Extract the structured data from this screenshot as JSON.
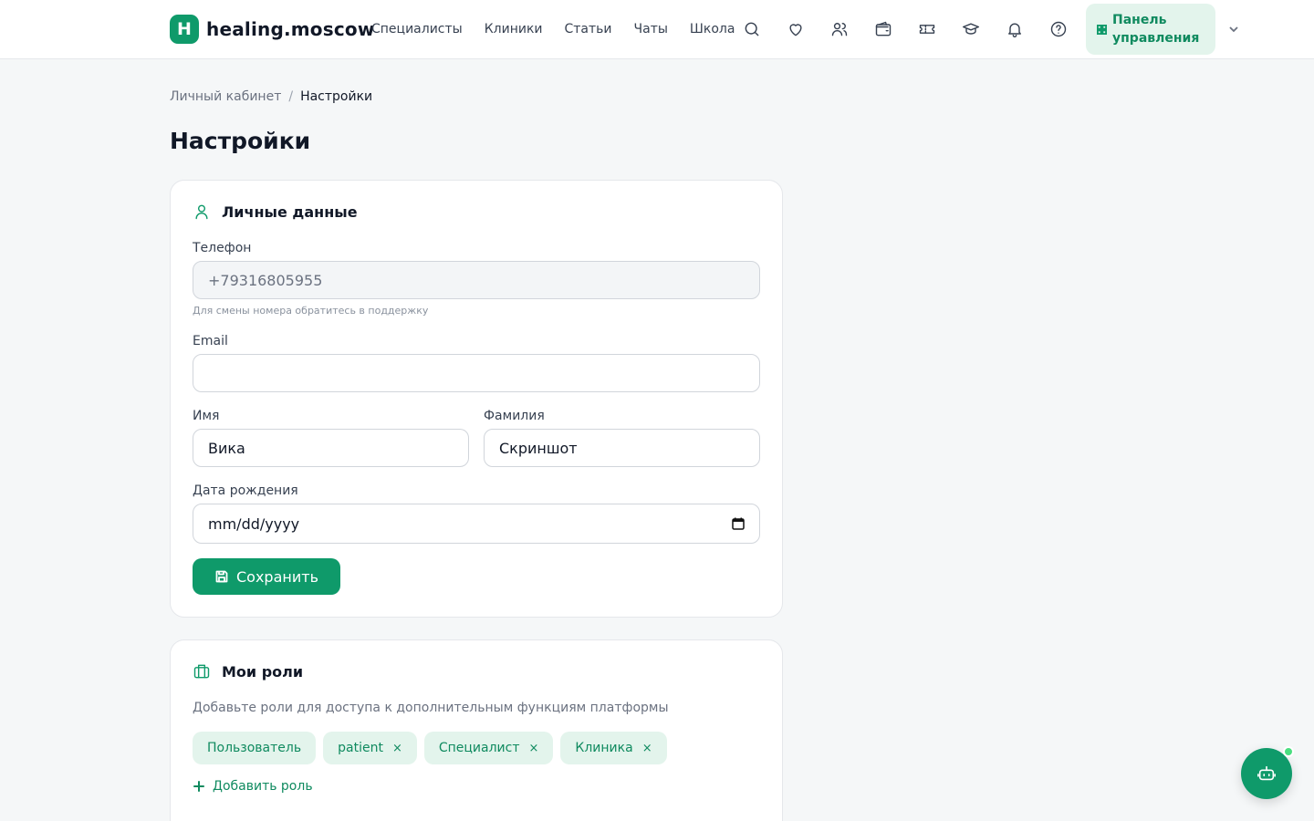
{
  "header": {
    "logo_letter": "H",
    "logo_text": "healing.moscow",
    "nav": [
      "Специалисты",
      "Клиники",
      "Статьи",
      "Чаты",
      "Школа"
    ],
    "icons": [
      "search-icon",
      "heart-icon",
      "users-icon",
      "wallet-icon",
      "ticket-icon",
      "graduation-cap-icon",
      "bell-icon",
      "help-icon"
    ],
    "panel_label": "Панель управления"
  },
  "breadcrumb": {
    "parent": "Личный кабинет",
    "separator": "/",
    "current": "Настройки"
  },
  "page_title": "Настройки",
  "personal": {
    "title": "Личные данные",
    "phone_label": "Телефон",
    "phone_value": "+79316805955",
    "phone_hint": "Для смены номера обратитесь в поддержку",
    "email_label": "Email",
    "email_value": "",
    "first_name_label": "Имя",
    "first_name_value": "Вика",
    "last_name_label": "Фамилия",
    "last_name_value": "Скриншот",
    "birth_label": "Дата рождения",
    "birth_value": "mm/dd/yyyy",
    "save_label": "Сохранить"
  },
  "roles": {
    "title": "Мои роли",
    "description": "Добавьте роли для доступа к дополнительным функциям платформы",
    "items": [
      {
        "label": "Пользователь",
        "removable": false
      },
      {
        "label": "patient",
        "removable": true
      },
      {
        "label": "Специалист",
        "removable": true
      },
      {
        "label": "Клиника",
        "removable": true
      }
    ],
    "remove_glyph": "×",
    "add_label": "Добавить роль"
  },
  "colors": {
    "accent": "#0f9a6a",
    "accent_light": "#e3f4ec",
    "background": "#f5f7f8"
  }
}
